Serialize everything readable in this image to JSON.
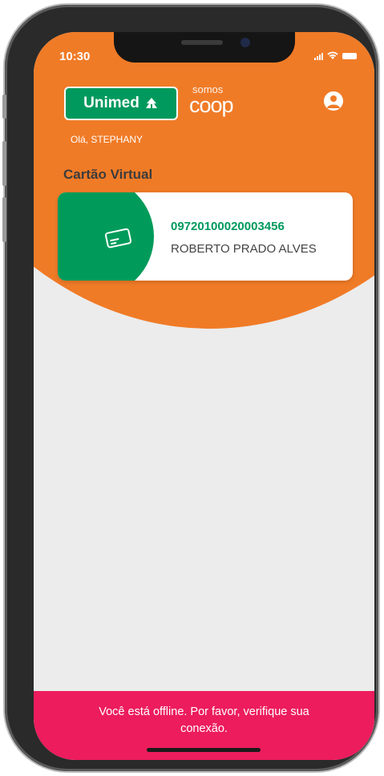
{
  "status_bar": {
    "time": "10:30",
    "icons": [
      "signal-icon",
      "wifi-icon",
      "battery-icon"
    ]
  },
  "header": {
    "brand_logo": "Unimed",
    "partner_logo_top": "somos",
    "partner_logo_bottom": "coop",
    "greeting": "Olá, STEPHANY",
    "profile_icon": "user-avatar-icon"
  },
  "section": {
    "title": "Cartão Virtual"
  },
  "card": {
    "number": "09720100020003456",
    "holder": "ROBERTO PRADO ALVES",
    "icon": "card-icon"
  },
  "offline_banner": {
    "message": "Você está offline. Por favor, verifique sua conexão."
  },
  "colors": {
    "header_orange": "#f07b27",
    "brand_green": "#00995d",
    "background": "#ececec",
    "offline_pink": "#ec1c5d"
  }
}
